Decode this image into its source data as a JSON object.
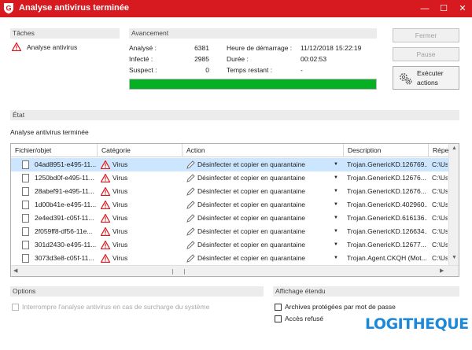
{
  "window": {
    "title": "Analyse antivirus terminée",
    "minimize": "—",
    "maximize": "☐",
    "close": "✕"
  },
  "tasks": {
    "header": "Tâches",
    "item_label": "Analyse antivirus"
  },
  "progress": {
    "header": "Avancement",
    "analyzed_label": "Analysé :",
    "analyzed_value": "6381",
    "infected_label": "Infecté :",
    "infected_value": "2985",
    "suspect_label": "Suspect :",
    "suspect_value": "0",
    "start_label": "Heure de démarrage :",
    "start_value": "11/12/2018 15:22:19",
    "duration_label": "Durée :",
    "duration_value": "00:02:53",
    "remaining_label": "Temps restant :",
    "remaining_value": "-",
    "bar_percent": 100,
    "bar_color": "#06b025"
  },
  "buttons": {
    "close": "Fermer",
    "pause": "Pause",
    "execute_line1": "Exécuter",
    "execute_line2": "actions"
  },
  "status": {
    "header": "État",
    "message": "Analyse antivirus terminée"
  },
  "table": {
    "columns": [
      "Fichier/objet",
      "Catégorie",
      "Action",
      "Description",
      "Réper"
    ],
    "rows": [
      {
        "file": "04ad8951-e495-11...",
        "category": "Virus",
        "action": "Désinfecter et copier en quarantaine",
        "description": "Trojan.GenericKD.126769...",
        "path": "C:\\Us",
        "selected": true
      },
      {
        "file": "1250bd0f-e495-11...",
        "category": "Virus",
        "action": "Désinfecter et copier en quarantaine",
        "description": "Trojan.GenericKD.12676...",
        "path": "C:\\Us",
        "selected": false
      },
      {
        "file": "28abef91-e495-11...",
        "category": "Virus",
        "action": "Désinfecter et copier en quarantaine",
        "description": "Trojan.GenericKD.12676...",
        "path": "C:\\Us",
        "selected": false
      },
      {
        "file": "1d00b41e-e495-11...",
        "category": "Virus",
        "action": "Désinfecter et copier en quarantaine",
        "description": "Trojan.GenericKD.402960...",
        "path": "C:\\Us",
        "selected": false
      },
      {
        "file": "2e4ed391-c05f-11...",
        "category": "Virus",
        "action": "Désinfecter et copier en quarantaine",
        "description": "Trojan.GenericKD.616136...",
        "path": "C:\\Us",
        "selected": false
      },
      {
        "file": "2f059ff8-df56-11e...",
        "category": "Virus",
        "action": "Désinfecter et copier en quarantaine",
        "description": "Trojan.GenericKD.126634...",
        "path": "C:\\Us",
        "selected": false
      },
      {
        "file": "301d2430-e495-11...",
        "category": "Virus",
        "action": "Désinfecter et copier en quarantaine",
        "description": "Trojan.GenericKD.12677...",
        "path": "C:\\Us",
        "selected": false
      },
      {
        "file": "3073d3e8-c05f-11...",
        "category": "Virus",
        "action": "Désinfecter et copier en quarantaine",
        "description": "Trojan.Agent.CKQH (Mot...",
        "path": "C:\\Us",
        "selected": false
      }
    ]
  },
  "options": {
    "header": "Options",
    "interrupt_label": "Interrompre l'analyse antivirus en cas de surcharge du système"
  },
  "extended": {
    "header": "Affichage étendu",
    "archives_label": "Archives protégées par mot de passe",
    "access_label": "Accès refusé"
  },
  "watermark": "LOGITHEQUE"
}
